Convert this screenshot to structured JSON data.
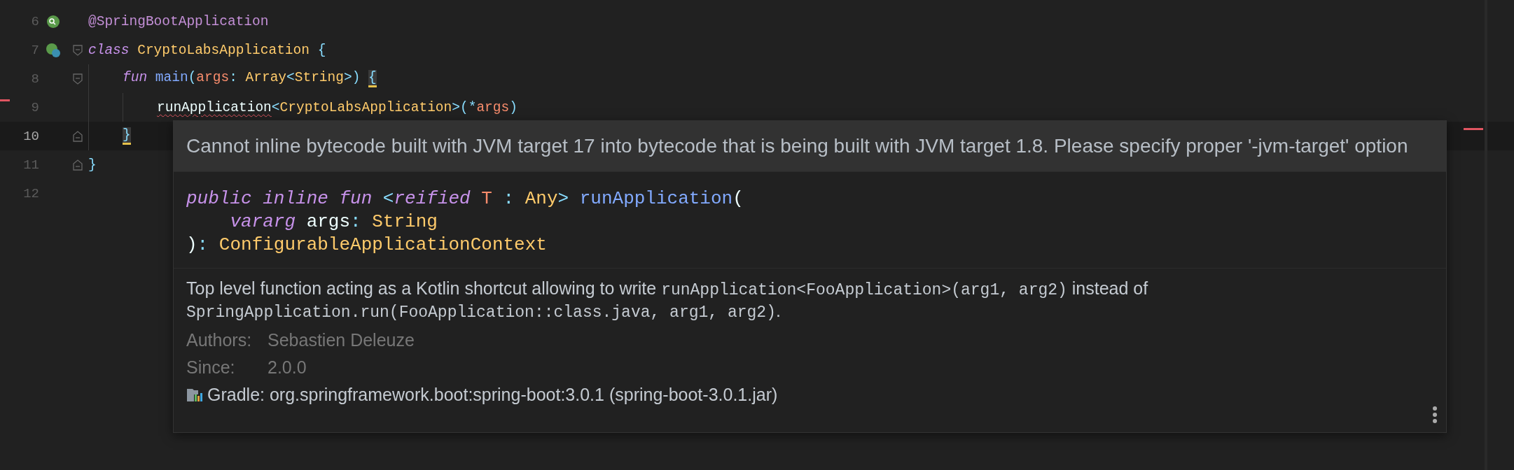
{
  "editor": {
    "lines": [
      {
        "number": "6",
        "current": false,
        "kind": "annotation",
        "tokens": [
          {
            "text": "@SpringBootApplication",
            "kind": "annotation"
          }
        ]
      },
      {
        "number": "7",
        "current": false,
        "kind": "classopen",
        "tokens": [
          {
            "text": "class ",
            "kind": "keyword"
          },
          {
            "text": "CryptoLabsApplication",
            "kind": "type"
          },
          {
            "text": " {",
            "kind": "punct"
          }
        ]
      },
      {
        "number": "8",
        "current": false,
        "kind": "funopen",
        "tokens": [
          {
            "text": "fun ",
            "kind": "keyword"
          },
          {
            "text": "main",
            "kind": "function"
          },
          {
            "text": "(",
            "kind": "punct"
          },
          {
            "text": "args",
            "kind": "param"
          },
          {
            "text": ": ",
            "kind": "punct"
          },
          {
            "text": "Array",
            "kind": "type"
          },
          {
            "text": "<",
            "kind": "punct"
          },
          {
            "text": "String",
            "kind": "type"
          },
          {
            "text": ">) ",
            "kind": "punct"
          },
          {
            "text": "{",
            "kind": "brace",
            "matched": true
          }
        ]
      },
      {
        "number": "9",
        "current": false,
        "kind": "statement",
        "tokens": [
          {
            "text": "runApplication",
            "kind": "plain",
            "error": true
          },
          {
            "text": "<",
            "kind": "punct"
          },
          {
            "text": "CryptoLabsApplication",
            "kind": "type"
          },
          {
            "text": ">(*",
            "kind": "punct"
          },
          {
            "text": "args",
            "kind": "param"
          },
          {
            "text": ")",
            "kind": "punct"
          }
        ]
      },
      {
        "number": "10",
        "current": true,
        "kind": "funclose",
        "tokens": [
          {
            "text": "}",
            "kind": "brace",
            "matched": true
          }
        ]
      },
      {
        "number": "11",
        "current": false,
        "kind": "classclose",
        "tokens": [
          {
            "text": "}",
            "kind": "punct"
          }
        ]
      },
      {
        "number": "12",
        "current": false,
        "kind": "blank"
      }
    ]
  },
  "popup": {
    "error": "Cannot inline bytecode built with JVM target 17 into bytecode that is being built with JVM target 1.8. Please specify proper '-jvm-target' option",
    "signature": [
      [
        {
          "text": "public inline fun ",
          "kind": "keyword"
        },
        {
          "text": "<",
          "kind": "punct"
        },
        {
          "text": "reified",
          "kind": "keyword"
        },
        {
          "text": " T",
          "kind": "param"
        },
        {
          "text": " : ",
          "kind": "punct"
        },
        {
          "text": "Any",
          "kind": "type"
        },
        {
          "text": ">",
          "kind": "punct"
        },
        {
          "text": " runApplication",
          "kind": "function"
        },
        {
          "text": "(",
          "kind": "plain"
        }
      ],
      [
        {
          "text": "    vararg",
          "kind": "keyword"
        },
        {
          "text": " args",
          "kind": "plain"
        },
        {
          "text": ": ",
          "kind": "punct"
        },
        {
          "text": "String",
          "kind": "type"
        }
      ],
      [
        {
          "text": ")",
          "kind": "plain"
        },
        {
          "text": ": ",
          "kind": "punct"
        },
        {
          "text": "ConfigurableApplicationContext",
          "kind": "type"
        }
      ]
    ],
    "description": [
      {
        "text": "Top level function acting as a Kotlin shortcut allowing to write ",
        "kind": "text"
      },
      {
        "text": "runApplication<FooApplication>(arg1, arg2)",
        "kind": "code"
      },
      {
        "text": " instead of ",
        "kind": "text"
      },
      {
        "text": "SpringApplication.run(FooApplication::class.java, arg1, arg2)",
        "kind": "code"
      },
      {
        "text": ".",
        "kind": "text"
      }
    ],
    "fields": [
      {
        "label": "Authors:",
        "value": "Sebastien Deleuze"
      },
      {
        "label": "Since:",
        "value": "2.0.0"
      }
    ],
    "library": "Gradle: org.springframework.boot:spring-boot:3.0.1 (spring-boot-3.0.1.jar)"
  }
}
